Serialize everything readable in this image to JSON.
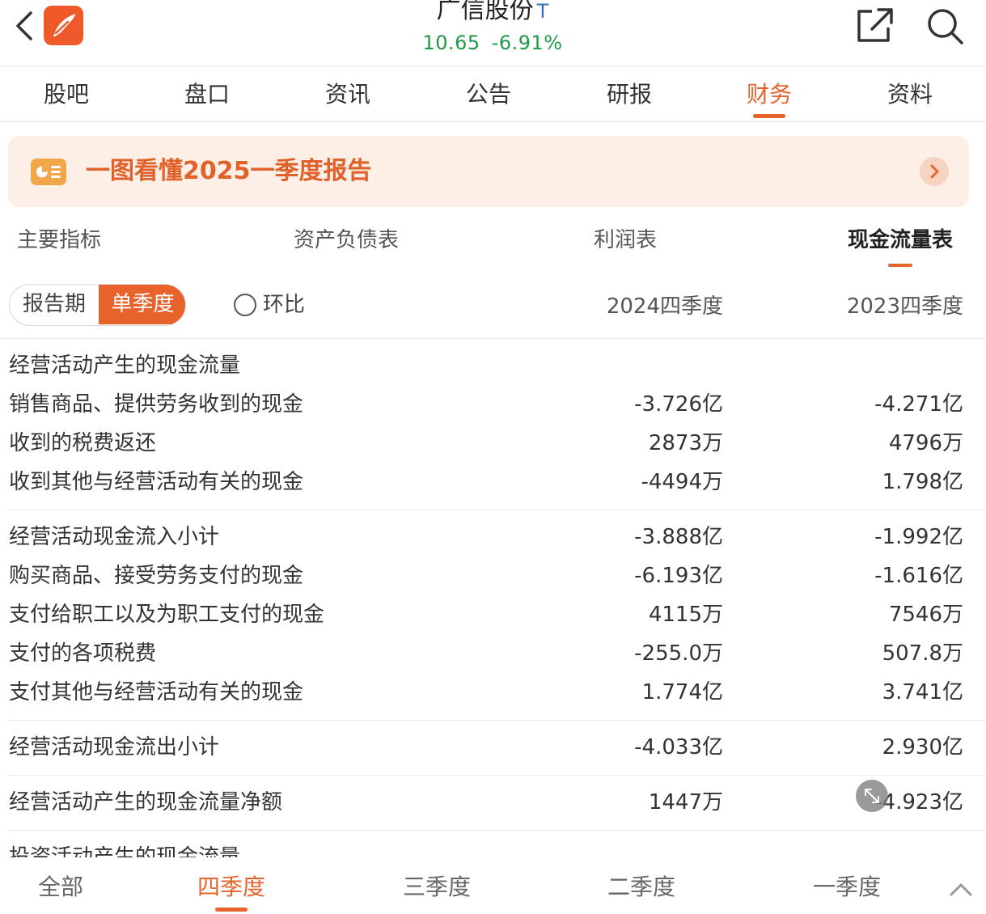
{
  "header": {
    "stock_name": "广信股份",
    "stock_tag": "T",
    "price": "10.65",
    "change": "-6.91%",
    "price_color": "#1f9b48",
    "accent": "#e8632b"
  },
  "main_tabs": [
    {
      "label": "股吧"
    },
    {
      "label": "盘口"
    },
    {
      "label": "资讯"
    },
    {
      "label": "公告"
    },
    {
      "label": "研报"
    },
    {
      "label": "财务",
      "active": true
    },
    {
      "label": "资料"
    }
  ],
  "banner": {
    "text": "一图看懂2025一季度报告"
  },
  "sub_tabs": [
    {
      "label": "主要指标"
    },
    {
      "label": "资产负债表"
    },
    {
      "label": "利润表"
    },
    {
      "label": "现金流量表",
      "active": true
    }
  ],
  "controls": {
    "seg_report_period": "报告期",
    "seg_single_quarter": "单季度",
    "radio_label": "环比",
    "col1": "2024四季度",
    "col2": "2023四季度"
  },
  "rows": [
    {
      "label": "经营活动产生的现金流量",
      "v1": "",
      "v2": ""
    },
    {
      "label": "销售商品、提供劳务收到的现金",
      "v1": "-3.726亿",
      "v2": "-4.271亿"
    },
    {
      "label": "收到的税费返还",
      "v1": "2873万",
      "v2": "4796万"
    },
    {
      "label": "收到其他与经营活动有关的现金",
      "v1": "-4494万",
      "v2": "1.798亿"
    },
    {
      "label": "经营活动现金流入小计",
      "v1": "-3.888亿",
      "v2": "-1.992亿"
    },
    {
      "label": "购买商品、接受劳务支付的现金",
      "v1": "-6.193亿",
      "v2": "-1.616亿"
    },
    {
      "label": "支付给职工以及为职工支付的现金",
      "v1": "4115万",
      "v2": "7546万"
    },
    {
      "label": "支付的各项税费",
      "v1": "-255.0万",
      "v2": "507.8万"
    },
    {
      "label": "支付其他与经营活动有关的现金",
      "v1": "1.774亿",
      "v2": "3.741亿"
    },
    {
      "label": "经营活动现金流出小计",
      "v1": "-4.033亿",
      "v2": "2.930亿"
    },
    {
      "label": "经营活动产生的现金流量净额",
      "v1": "1447万",
      "v2": "-4.923亿"
    },
    {
      "label": "投资活动产生的现金流量",
      "v1": "",
      "v2": ""
    }
  ],
  "bottom_tabs": [
    {
      "label": "全部"
    },
    {
      "label": "四季度",
      "active": true
    },
    {
      "label": "三季度"
    },
    {
      "label": "二季度"
    },
    {
      "label": "一季度"
    }
  ]
}
